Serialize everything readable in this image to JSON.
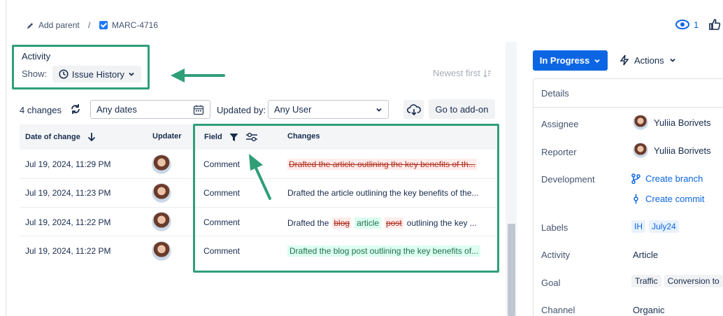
{
  "breadcrumb": {
    "add_parent": "Add parent",
    "separator": "/",
    "issue_key": "MARC-4716"
  },
  "watch": {
    "count": "1"
  },
  "activity": {
    "title": "Activity",
    "show_label": "Show:",
    "show_value": "Issue History",
    "sort": "Newest first"
  },
  "toolbar": {
    "changes_count": "4 changes",
    "dates_value": "Any dates",
    "updated_by_label": "Updated by:",
    "user_value": "Any User",
    "addon_button": "Go to add-on"
  },
  "table": {
    "headers": {
      "date": "Date of change",
      "updater": "Updater",
      "field": "Field",
      "changes": "Changes"
    },
    "rows": [
      {
        "date": "Jul 19, 2024, 11:29 PM",
        "field": "Comment",
        "change": "Drafted the article outlining the key benefits of th..."
      },
      {
        "date": "Jul 19, 2024, 11:23 PM",
        "field": "Comment",
        "change": "Drafted the article outlining the key benefits of the..."
      },
      {
        "date": "Jul 19, 2024, 11:22 PM",
        "field": "Comment",
        "change_parts": [
          "Drafted the",
          "blog",
          "article",
          "post",
          "outlining the key ..."
        ]
      },
      {
        "date": "Jul 19, 2024, 11:22 PM",
        "field": "Comment",
        "change": "Drafted the blog post outlining the key benefits of..."
      }
    ]
  },
  "right_panel": {
    "status": "In Progress",
    "actions": "Actions",
    "details_title": "Details",
    "fields": {
      "assignee_label": "Assignee",
      "assignee_value": "Yuliia Borivets",
      "reporter_label": "Reporter",
      "reporter_value": "Yuliia Borivets",
      "development_label": "Development",
      "create_branch": "Create branch",
      "create_commit": "Create commit",
      "labels_label": "Labels",
      "label_1": "IH",
      "label_2": "July24",
      "activity_label": "Activity",
      "activity_value": "Article",
      "goal_label": "Goal",
      "goal_1": "Traffic",
      "goal_2": "Conversion to",
      "channel_label": "Channel",
      "channel_value": "Organic"
    }
  },
  "colors": {
    "annotation": "#2f9f78",
    "primary": "#0c66e4"
  }
}
